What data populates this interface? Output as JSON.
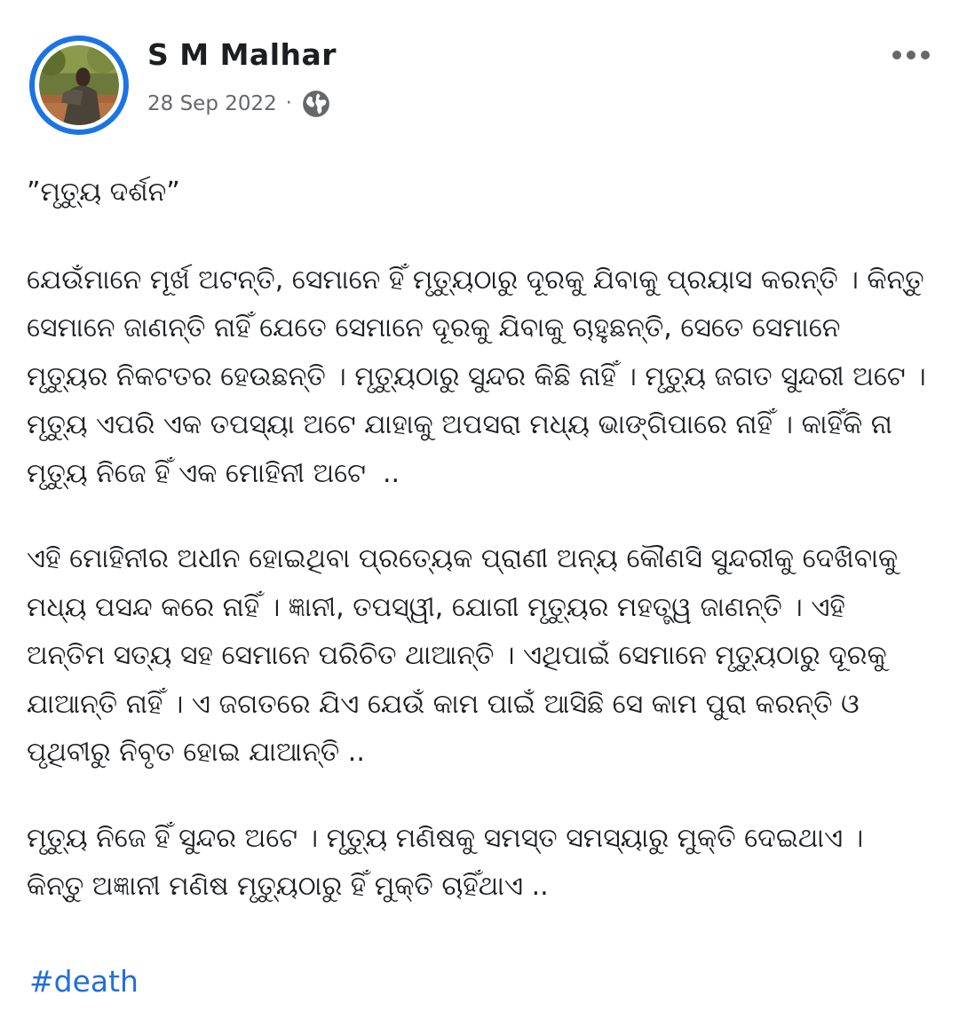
{
  "post": {
    "author": "S M Malhar",
    "date": "28 Sep 2022",
    "separator": "·",
    "privacy_icon": "globe-icon",
    "more_icon": "more-dots-icon",
    "title": "”ମୃତ୍ୟୁ ଦର୍ଶନ”",
    "paragraphs": [
      "ଯେଉଁମାନେ ମୂର୍ଖ ଅଟନ୍ତି, ସେମାନେ ହିଁ ମୃତ୍ୟୁଠାରୁ ଦୂରକୁ ଯିବାକୁ ପ୍ରୟାସ କରନ୍ତି । କିନ୍ତୁ ସେମାନେ ଜାଣନ୍ତି ନାହିଁ ଯେତେ ସେମାନେ ଦୂରକୁ ଯିବାକୁ ଚାହୁଛନ୍ତି, ସେତେ ସେମାନେ ମୃତ୍ୟୁର ନିକଟତର ହେଉଛନ୍ତି । ମୃତ୍ୟୁଠାରୁ ସୁନ୍ଦର କିଛି ନାହିଁ । ମୃତ୍ୟୁ ଜଗତ ସୁନ୍ଦରୀ ଅଟେ । ମୃତ୍ୟୁ ଏପରି ଏକ ତପସ୍ୟା ଅଟେ ଯାହାକୁ ଅପସରା ମଧ୍ୟ ଭାଙ୍ଗିପାରେ ନାହିଁ । କାହିଁକି ନା ମୃତ୍ୟୁ ନିଜେ ହିଁ ଏକ ମୋହିନୀ ଅଟେ  ..",
      "ଏହି ମୋହିନୀର ଅଧୀନ ହୋଇଥିବା ପ୍ରତ୍ୟେକ ପ୍ରାଣୀ ଅନ୍ୟ କୌଣସି ସୁନ୍ଦରୀକୁ ଦେଖିବାକୁ ମଧ୍ୟ ପସନ୍ଦ କରେ ନାହିଁ । ଜ୍ଞାନୀ, ତପସ୍ୱୀ, ଯୋଗୀ ମୃତ୍ୟୁର ମହତ୍ତ୍ୱ ଜାଣନ୍ତି । ଏହି ଅନ୍ତିମ ସତ୍ୟ ସହ ସେମାନେ ପରିଚିତ ଥାଆନ୍ତି । ଏଥିପାଇଁ ସେମାନେ ମୃତ୍ୟୁଠାରୁ ଦୂରକୁ ଯାଆନ୍ତି ନାହିଁ । ଏ ଜଗତରେ ଯିଏ ଯେଉଁ କାମ ପାଇଁ ଆସିଛି ସେ କାମ ପୁରା କରନ୍ତି ଓ ପୃଥିବୀରୁ ନିବୃତ ହୋଇ ଯାଆନ୍ତି ..",
      "ମୃତ୍ୟୁ ନିଜେ ହିଁ ସୁନ୍ଦର ଅଟେ । ମୃତ୍ୟୁ ମଣିଷକୁ ସମସ୍ତ ସମସ୍ୟାରୁ ମୁକ୍ତି ଦେଇଥାଏ । କିନ୍ତୁ ଅଜ୍ଞାନୀ ମଣିଷ ମୃତ୍ୟୁଠାରୁ ହିଁ ମୁକ୍ତି ଚାହିଁଥାଏ .."
    ],
    "hashtag": "#death"
  },
  "colors": {
    "avatar_ring": "#1b74e4",
    "text": "#1c1e21",
    "meta": "#65676b",
    "link": "#216fdb"
  }
}
